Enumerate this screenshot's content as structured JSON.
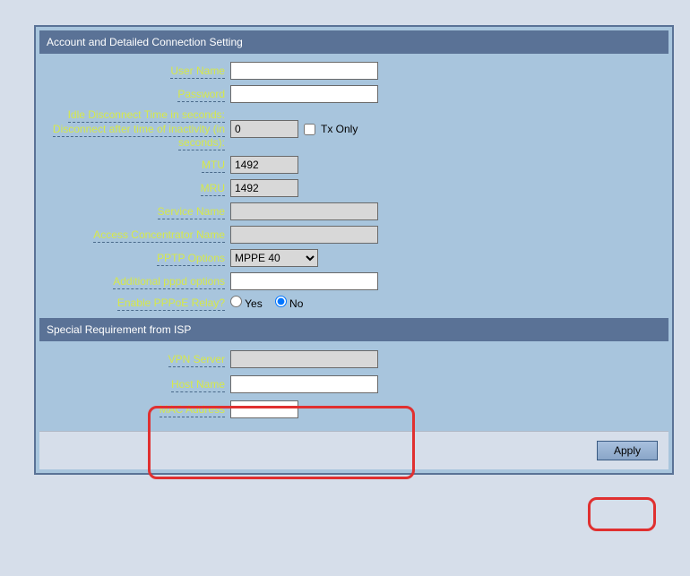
{
  "sections": {
    "account": {
      "title": "Account and Detailed Connection Setting",
      "user_name_label": "User Name",
      "user_name_value": "",
      "password_label": "Password",
      "password_value": "",
      "idle_label_line1": "Idle Disconnect Time in seconds:",
      "idle_label_line2": "Disconnect after time of inactivity (in",
      "idle_label_line3": "seconds):",
      "idle_value": "0",
      "tx_only_label": "Tx Only",
      "mtu_label": "MTU",
      "mtu_value": "1492",
      "mru_label": "MRU",
      "mru_value": "1492",
      "service_name_label": "Service Name",
      "service_name_value": "",
      "acn_label": "Access Concentrator Name",
      "acn_value": "",
      "pptp_label": "PPTP Options",
      "pptp_value": "MPPE 40",
      "addl_pppd_label": "Additional pppd options",
      "addl_pppd_value": "",
      "enable_relay_label": "Enable PPPoE Relay?",
      "radio_yes": "Yes",
      "radio_no": "No"
    },
    "isp": {
      "title": "Special Requirement from ISP",
      "vpn_server_label": "VPN Server",
      "vpn_server_value": "",
      "host_name_label": "Host Name",
      "host_name_value": "",
      "mac_address_label": "MAC Address",
      "mac_address_value": ""
    }
  },
  "buttons": {
    "apply": "Apply"
  }
}
